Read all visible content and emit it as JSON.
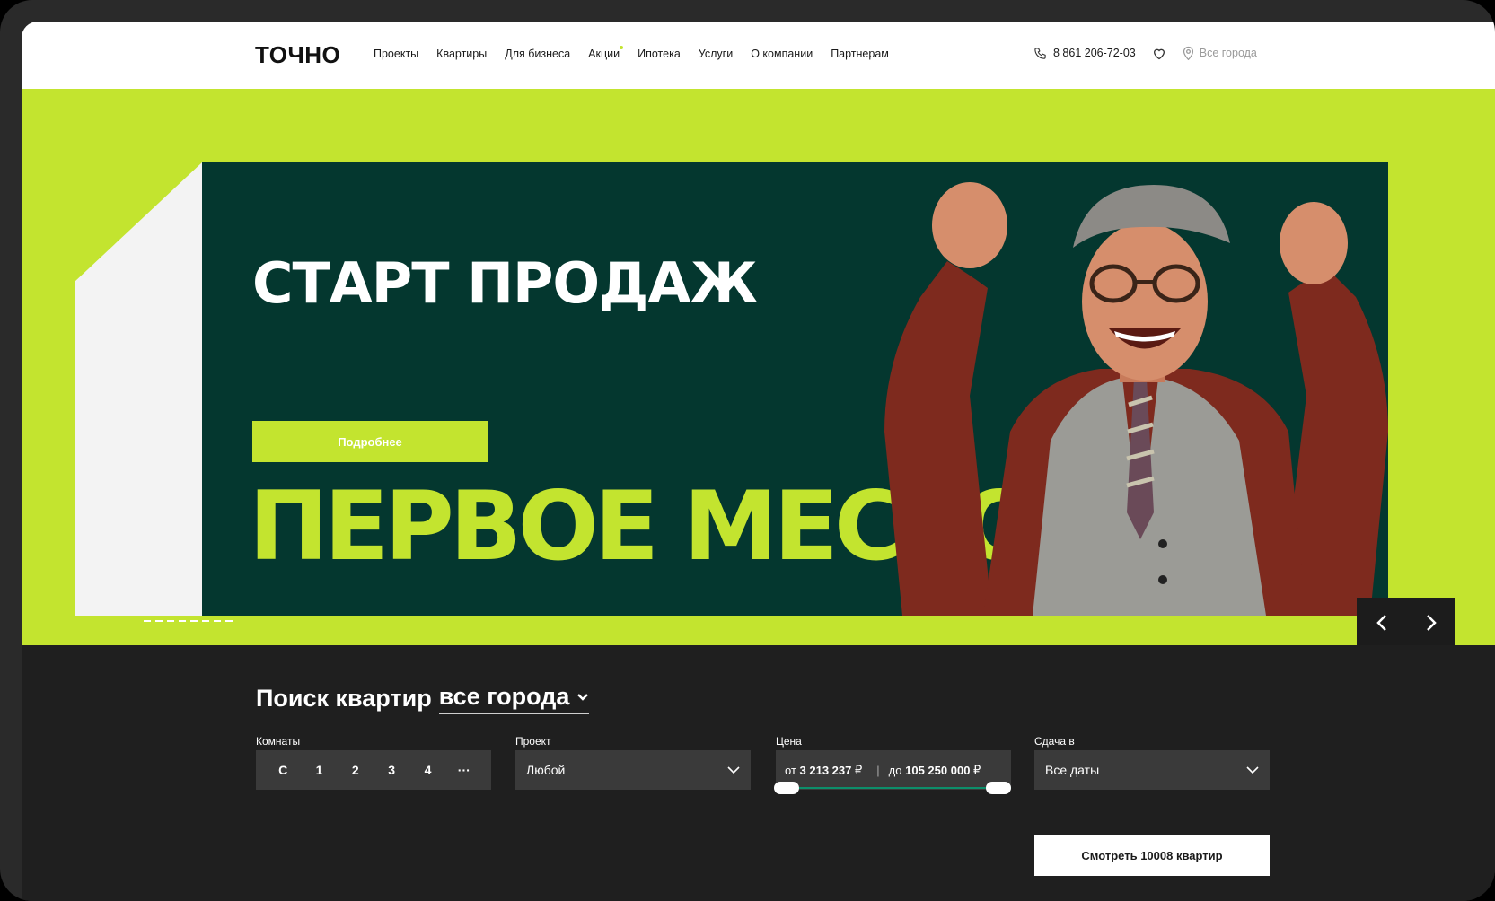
{
  "header": {
    "logo": "ТОЧНО",
    "nav": [
      "Проекты",
      "Квартиры",
      "Для бизнеса",
      "Акции",
      "Ипотека",
      "Услуги",
      "О компании",
      "Партнерам"
    ],
    "phone": "8 861 206-72-03",
    "city": "Все города",
    "icons": {
      "phone": "phone-icon",
      "favorite": "heart-icon",
      "city": "location-pin-icon"
    }
  },
  "hero": {
    "title": "СТАРТ ПРОДАЖ",
    "button": "Подробнее",
    "slogan": "ПЕРВОЕ МЕСТО",
    "slider_prev": "‹",
    "slider_next": "›"
  },
  "search": {
    "title": "Поиск квартир",
    "city_select": "все города",
    "rooms_label": "Комнаты",
    "rooms": [
      "С",
      "1",
      "2",
      "3",
      "4",
      "···"
    ],
    "project_label": "Проект",
    "project_value": "Любой",
    "price_label": "Цена",
    "price_from_prefix": "от",
    "price_from": "3 213 237",
    "price_to_prefix": "до",
    "price_to": "105 250 000",
    "currency": "₽",
    "date_label": "Сдача в",
    "date_value": "Все даты",
    "submit": "Смотреть 10008 квартир"
  },
  "colors": {
    "accent": "#c3e42f",
    "banner": "#04372f",
    "dark": "#1f1f1f",
    "field": "#3a3a3a",
    "track": "#0c8e6a"
  }
}
